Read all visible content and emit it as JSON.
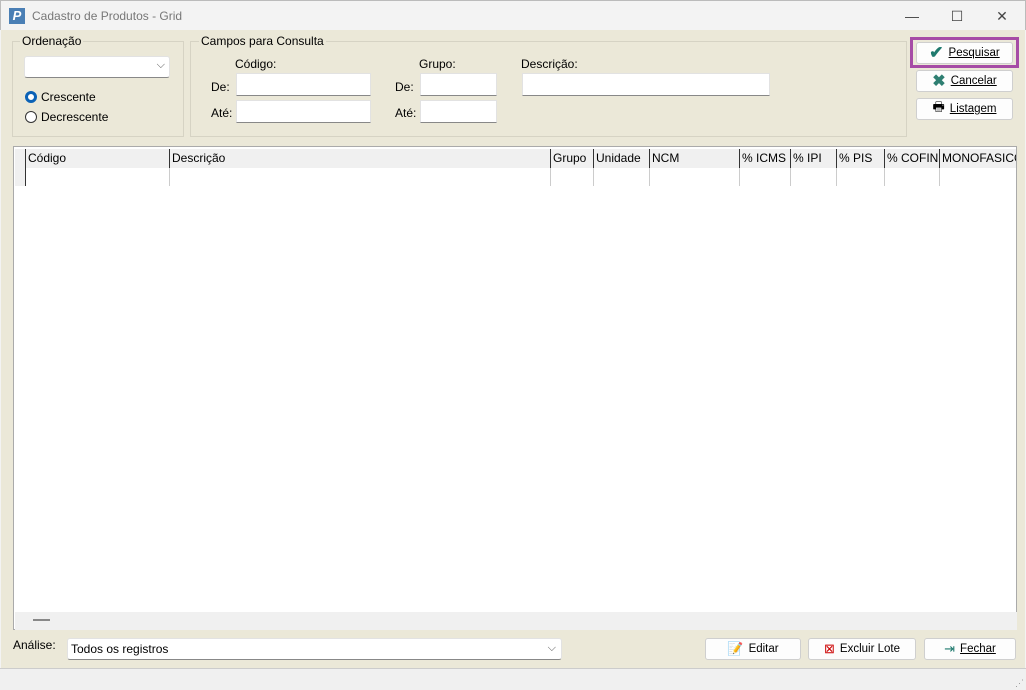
{
  "window": {
    "title": "Cadastro de Produtos - Grid",
    "minimize": "—",
    "maximize": "☐",
    "close": "✕"
  },
  "ordenacao": {
    "legend": "Ordenação",
    "select_value": "",
    "radios": [
      {
        "label": "Crescente",
        "checked": true
      },
      {
        "label": "Decrescente",
        "checked": false
      }
    ]
  },
  "consulta": {
    "legend": "Campos para Consulta",
    "codigo_label": "Código:",
    "grupo_label": "Grupo:",
    "descricao_label": "Descrição:",
    "de_label": "De:",
    "ate_label": "Até:"
  },
  "actions": {
    "pesquisar": "Pesquisar",
    "cancelar": "Cancelar",
    "listagem": "Listagem"
  },
  "grid": {
    "columns": [
      "Código",
      "Descrição",
      "Grupo",
      "Unidade",
      "NCM",
      "% ICMS",
      "% IPI",
      "% PIS",
      "% COFIN",
      "MONOFASICO"
    ]
  },
  "footer": {
    "analise_label": "Análise:",
    "analise_value": "Todos os registros",
    "editar": "Editar",
    "excluir": "Excluir Lote",
    "fechar": "Fechar"
  },
  "colors": {
    "accent": "#0b62b6",
    "highlight": "#a64ca6",
    "background": "#ebe8d8"
  }
}
